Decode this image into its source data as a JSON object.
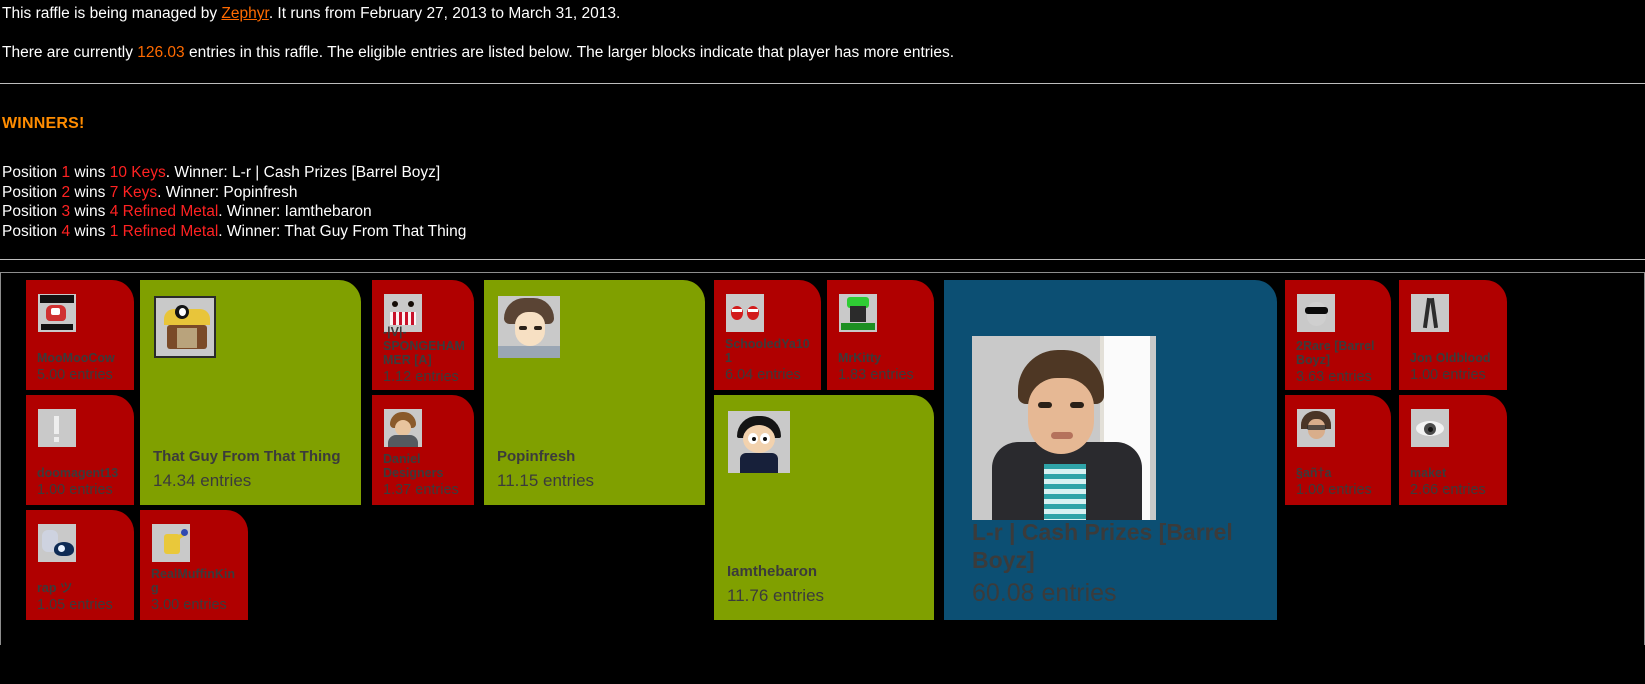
{
  "intro": {
    "line1_a": "This raffle is being managed by ",
    "manager": "Zephyr",
    "line1_b": ". It runs from February 27, 2013 to March 31, 2013.",
    "line2_a": "There are currently ",
    "total_entries": "126.03",
    "line2_b": " entries in this raffle. The eligible entries are listed below. The larger blocks indicate that player has more entries."
  },
  "winners": {
    "title": "WINNERS!",
    "rows": [
      {
        "prefix": "Position ",
        "position": "1",
        "wins": " wins ",
        "prize": "10 Keys",
        "winner_label": ". Winner: ",
        "winner": "L-r | Cash Prizes [Barrel Boyz]"
      },
      {
        "prefix": "Position ",
        "position": "2",
        "wins": " wins ",
        "prize": "7 Keys",
        "winner_label": ". Winner: ",
        "winner": "Popinfresh"
      },
      {
        "prefix": "Position ",
        "position": "3",
        "wins": " wins ",
        "prize": "4 Refined Metal",
        "winner_label": ". Winner: ",
        "winner": "Iamthebaron"
      },
      {
        "prefix": "Position ",
        "position": "4",
        "wins": " wins ",
        "prize": "1 Refined Metal",
        "winner_label": ". Winner: ",
        "winner": "That Guy From That Thing"
      }
    ]
  },
  "colors": {
    "red_tile": "#b00000",
    "green_tile": "#80a000",
    "blue_tile": "#0c4f73",
    "winners_heading": "#ff8c00",
    "manager_link": "#ff6a00",
    "highlight_red": "#ff2222",
    "background": "#000000",
    "tile_text": "#3b3b3b"
  },
  "board": {
    "entries_suffix": "entries",
    "tiles": [
      {
        "name": "MooMooCow",
        "entries": "5.00 entries",
        "color": "red",
        "avatar": "moomoocow-avatar"
      },
      {
        "name": "doomagent13",
        "entries": "1.00 entries",
        "color": "red",
        "avatar": "doomagent13-avatar"
      },
      {
        "name": "rap ツ",
        "entries": "1.05 entries",
        "color": "red",
        "avatar": "rap-avatar"
      },
      {
        "name": "That Guy From That Thing",
        "entries": "14.34 entries",
        "color": "green",
        "avatar": "thatguyfromthatthing-avatar"
      },
      {
        "name": "RealMuffinKing",
        "entries": "3.00 entries",
        "color": "red",
        "avatar": "realmuffinking-avatar"
      },
      {
        "name": "-|V|-SPONGEHAMMER [A]",
        "entries": "1.12 entries",
        "color": "red",
        "avatar": "spongehammer-avatar"
      },
      {
        "name": "Daniel Designers",
        "entries": "1.37 entries",
        "color": "red",
        "avatar": "danieldesigners-avatar"
      },
      {
        "name": "Popinfresh",
        "entries": "11.15 entries",
        "color": "green",
        "avatar": "popinfresh-avatar"
      },
      {
        "name": "SchooledYa101",
        "entries": "6.04 entries",
        "color": "red",
        "avatar": "schooledya101-avatar"
      },
      {
        "name": "MrKitty",
        "entries": "1.83 entries",
        "color": "red",
        "avatar": "mrkitty-avatar"
      },
      {
        "name": "Iamthebaron",
        "entries": "11.76 entries",
        "color": "green",
        "avatar": "iamthebaron-avatar"
      },
      {
        "name": "L-r | Cash Prizes [Barrel Boyz]",
        "entries": "60.08 entries",
        "color": "blue",
        "avatar": "lr-cash-prizes-avatar"
      },
      {
        "name": "2Rare [Barrel Boyz]",
        "entries": "3.63 entries",
        "color": "red",
        "avatar": "2rare-avatar"
      },
      {
        "name": "§añ†a",
        "entries": "1.00 entries",
        "color": "red",
        "avatar": "santa-avatar"
      },
      {
        "name": "Jon Oldblood",
        "entries": "1.00 entries",
        "color": "red",
        "avatar": "jonoldblood-avatar"
      },
      {
        "name": "maket",
        "entries": "2.66 entries",
        "color": "red",
        "avatar": "maket-avatar"
      }
    ]
  }
}
